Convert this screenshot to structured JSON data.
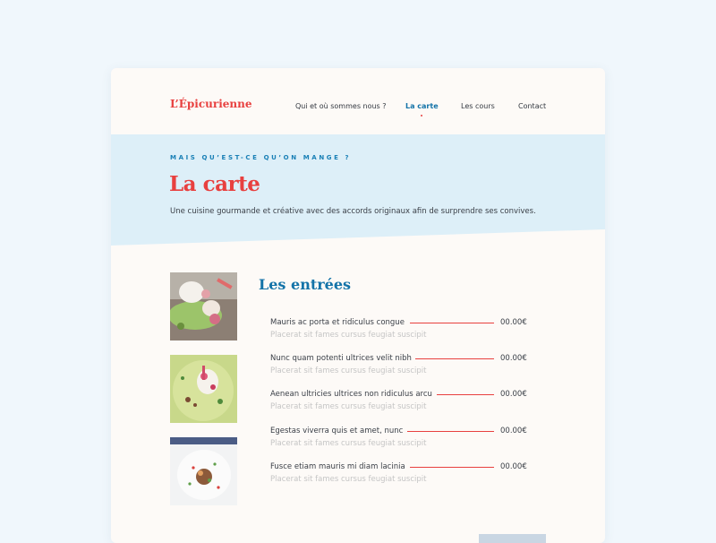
{
  "brand": "L’Épicurienne",
  "nav": {
    "items": [
      {
        "label": "Qui et où sommes nous ?",
        "active": false
      },
      {
        "label": "La carte",
        "active": true
      },
      {
        "label": "Les cours",
        "active": false
      },
      {
        "label": "Contact",
        "active": false
      }
    ]
  },
  "hero": {
    "eyebrow": "MAIS QU’EST-CE QU’ON MANGE ?",
    "title": "La carte",
    "subtitle": "Une cuisine gourmande et créative avec des accords originaux afin de surprendre ses convives."
  },
  "section": {
    "title": "Les entrées",
    "items": [
      {
        "name": "Mauris ac porta et ridiculus congue",
        "price": "00.00€",
        "desc": "Placerat sit fames cursus feugiat suscipit"
      },
      {
        "name": "Nunc quam potenti ultrices velit nibh",
        "price": "00.00€",
        "desc": "Placerat sit fames cursus feugiat suscipit"
      },
      {
        "name": "Aenean ultricies ultrices non ridiculus arcu",
        "price": "00.00€",
        "desc": "Placerat sit fames cursus feugiat suscipit"
      },
      {
        "name": "Egestas viverra quis et amet, nunc",
        "price": "00.00€",
        "desc": "Placerat sit fames cursus feugiat suscipit"
      },
      {
        "name": "Fusce etiam mauris mi diam lacinia",
        "price": "00.00€",
        "desc": "Placerat sit fames cursus feugiat suscipit"
      }
    ]
  },
  "colors": {
    "page_bg": "#f0f7fc",
    "card_bg": "#fdfaf7",
    "hero_bg": "#ddeff8",
    "accent_red": "#e8403f",
    "accent_blue": "#1373a8",
    "muted_text": "#c5c5c5"
  }
}
